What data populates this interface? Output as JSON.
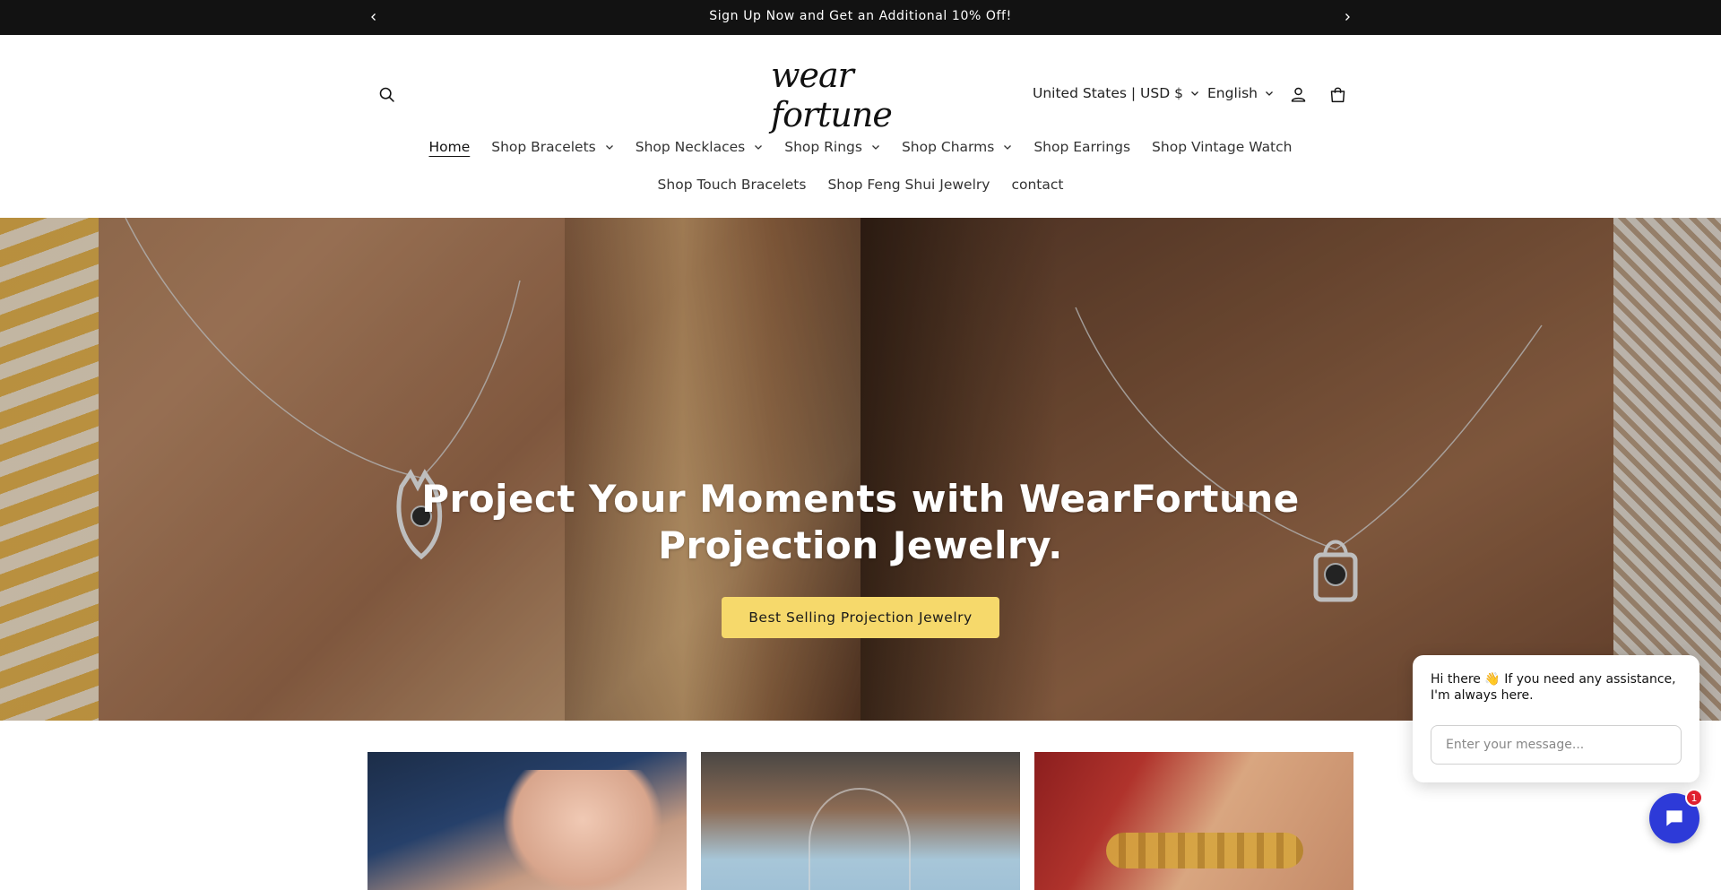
{
  "announcement": {
    "message": "Sign Up Now and Get an Additional 10% Off!",
    "prev_icon": "chevron-left-icon",
    "next_icon": "chevron-right-icon"
  },
  "header": {
    "logo_text": "wear fortune",
    "country_selector": "United States | USD $",
    "language_selector": "English",
    "icons": [
      "search-icon",
      "account-icon",
      "cart-icon"
    ]
  },
  "nav": {
    "row1": [
      {
        "label": "Home",
        "active": true,
        "dropdown": false
      },
      {
        "label": "Shop Bracelets",
        "dropdown": true
      },
      {
        "label": "Shop Necklaces",
        "dropdown": true
      },
      {
        "label": "Shop Rings",
        "dropdown": true
      },
      {
        "label": "Shop Charms",
        "dropdown": true
      },
      {
        "label": "Shop Earrings",
        "dropdown": false
      },
      {
        "label": "Shop Vintage Watch",
        "dropdown": false
      }
    ],
    "row2": [
      {
        "label": "Shop Touch Bracelets"
      },
      {
        "label": "Shop Feng Shui Jewelry"
      },
      {
        "label": "contact"
      }
    ]
  },
  "hero": {
    "title_line1": "Project Your Moments with WearFortune",
    "title_line2": "Projection Jewelry.",
    "cta_label": "Best Selling Projection Jewelry",
    "cta_color": "#f6d96b"
  },
  "chat": {
    "greeting": "Hi there 👋 If you need any assistance, I'm always here.",
    "input_placeholder": "Enter your message...",
    "badge_count": "1",
    "accent": "#2d3ad8"
  }
}
